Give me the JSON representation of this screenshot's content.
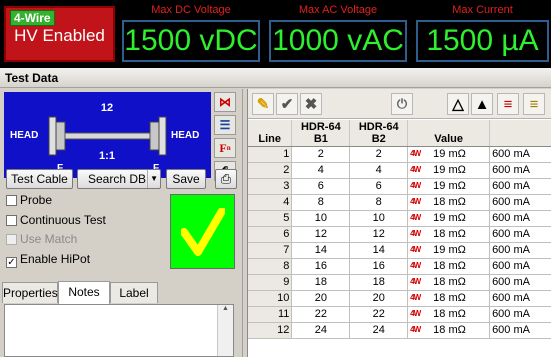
{
  "status": {
    "wire_badge": "4-Wire",
    "hv_text": "HV Enabled"
  },
  "meters": [
    {
      "label": "Max DC Voltage",
      "value": "1500 vDC"
    },
    {
      "label": "Max AC Voltage",
      "value": "1000 vAC"
    },
    {
      "label": "Max Current",
      "value": "1500 µA"
    }
  ],
  "panel": {
    "title": "Test Data"
  },
  "cable": {
    "top_count": "12",
    "left_label": "HEAD",
    "right_label": "HEAD",
    "left_gender": "F",
    "right_gender": "F",
    "ratio": "1:1"
  },
  "left_tools": [
    "hi-icon",
    "list-icon",
    "fn-icon",
    "print-icon"
  ],
  "buttons": {
    "test_cable": "Test Cable",
    "search_db": "Search DB",
    "save": "Save"
  },
  "options": [
    {
      "label": "Probe",
      "checked": false,
      "enabled": true
    },
    {
      "label": "Continuous Test",
      "checked": false,
      "enabled": true
    },
    {
      "label": "Use Match",
      "checked": false,
      "enabled": false
    },
    {
      "label": "Enable HiPot",
      "checked": true,
      "enabled": true
    }
  ],
  "result": {
    "color": "#00ff00",
    "mark_color": "#ffff00"
  },
  "tabs": [
    {
      "label": "Properties"
    },
    {
      "label": "Notes"
    },
    {
      "label": "Label"
    }
  ],
  "active_tab": "Notes",
  "grid": {
    "headers": {
      "line": "Line",
      "b1_top": "HDR-64",
      "b1": "B1",
      "b2_top": "HDR-64",
      "b2": "B2",
      "value": "Value"
    },
    "rows": [
      {
        "line": "1",
        "b1": "2",
        "b2": "2",
        "value": "19 mΩ",
        "current": "600 mA"
      },
      {
        "line": "2",
        "b1": "4",
        "b2": "4",
        "value": "19 mΩ",
        "current": "600 mA"
      },
      {
        "line": "3",
        "b1": "6",
        "b2": "6",
        "value": "19 mΩ",
        "current": "600 mA"
      },
      {
        "line": "4",
        "b1": "8",
        "b2": "8",
        "value": "18 mΩ",
        "current": "600 mA"
      },
      {
        "line": "5",
        "b1": "10",
        "b2": "10",
        "value": "19 mΩ",
        "current": "600 mA"
      },
      {
        "line": "6",
        "b1": "12",
        "b2": "12",
        "value": "18 mΩ",
        "current": "600 mA"
      },
      {
        "line": "7",
        "b1": "14",
        "b2": "14",
        "value": "19 mΩ",
        "current": "600 mA"
      },
      {
        "line": "8",
        "b1": "16",
        "b2": "16",
        "value": "18 mΩ",
        "current": "600 mA"
      },
      {
        "line": "9",
        "b1": "18",
        "b2": "18",
        "value": "18 mΩ",
        "current": "600 mA"
      },
      {
        "line": "10",
        "b1": "20",
        "b2": "20",
        "value": "18 mΩ",
        "current": "600 mA"
      },
      {
        "line": "11",
        "b1": "22",
        "b2": "22",
        "value": "18 mΩ",
        "current": "600 mA"
      },
      {
        "line": "12",
        "b1": "24",
        "b2": "24",
        "value": "18 mΩ",
        "current": "600 mA"
      }
    ]
  },
  "ohm_icon_text": "4W"
}
